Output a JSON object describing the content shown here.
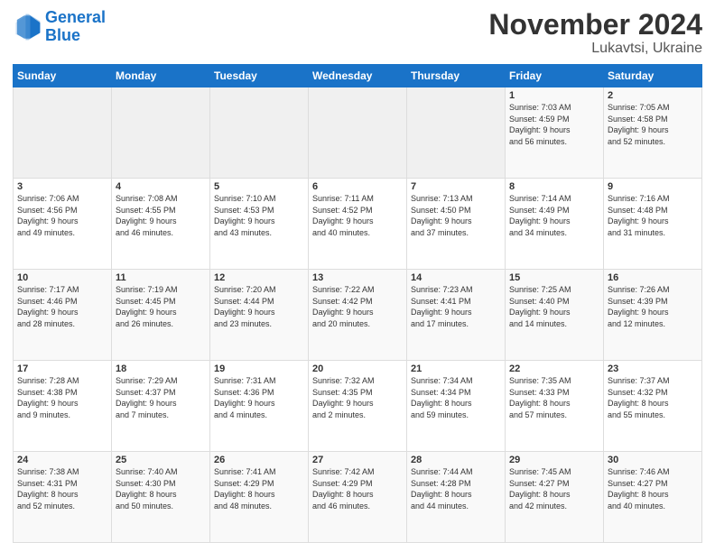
{
  "logo": {
    "line1": "General",
    "line2": "Blue"
  },
  "title": "November 2024",
  "subtitle": "Lukavtsi, Ukraine",
  "days_header": [
    "Sunday",
    "Monday",
    "Tuesday",
    "Wednesday",
    "Thursday",
    "Friday",
    "Saturday"
  ],
  "weeks": [
    [
      {
        "day": "",
        "info": ""
      },
      {
        "day": "",
        "info": ""
      },
      {
        "day": "",
        "info": ""
      },
      {
        "day": "",
        "info": ""
      },
      {
        "day": "",
        "info": ""
      },
      {
        "day": "1",
        "info": "Sunrise: 7:03 AM\nSunset: 4:59 PM\nDaylight: 9 hours\nand 56 minutes."
      },
      {
        "day": "2",
        "info": "Sunrise: 7:05 AM\nSunset: 4:58 PM\nDaylight: 9 hours\nand 52 minutes."
      }
    ],
    [
      {
        "day": "3",
        "info": "Sunrise: 7:06 AM\nSunset: 4:56 PM\nDaylight: 9 hours\nand 49 minutes."
      },
      {
        "day": "4",
        "info": "Sunrise: 7:08 AM\nSunset: 4:55 PM\nDaylight: 9 hours\nand 46 minutes."
      },
      {
        "day": "5",
        "info": "Sunrise: 7:10 AM\nSunset: 4:53 PM\nDaylight: 9 hours\nand 43 minutes."
      },
      {
        "day": "6",
        "info": "Sunrise: 7:11 AM\nSunset: 4:52 PM\nDaylight: 9 hours\nand 40 minutes."
      },
      {
        "day": "7",
        "info": "Sunrise: 7:13 AM\nSunset: 4:50 PM\nDaylight: 9 hours\nand 37 minutes."
      },
      {
        "day": "8",
        "info": "Sunrise: 7:14 AM\nSunset: 4:49 PM\nDaylight: 9 hours\nand 34 minutes."
      },
      {
        "day": "9",
        "info": "Sunrise: 7:16 AM\nSunset: 4:48 PM\nDaylight: 9 hours\nand 31 minutes."
      }
    ],
    [
      {
        "day": "10",
        "info": "Sunrise: 7:17 AM\nSunset: 4:46 PM\nDaylight: 9 hours\nand 28 minutes."
      },
      {
        "day": "11",
        "info": "Sunrise: 7:19 AM\nSunset: 4:45 PM\nDaylight: 9 hours\nand 26 minutes."
      },
      {
        "day": "12",
        "info": "Sunrise: 7:20 AM\nSunset: 4:44 PM\nDaylight: 9 hours\nand 23 minutes."
      },
      {
        "day": "13",
        "info": "Sunrise: 7:22 AM\nSunset: 4:42 PM\nDaylight: 9 hours\nand 20 minutes."
      },
      {
        "day": "14",
        "info": "Sunrise: 7:23 AM\nSunset: 4:41 PM\nDaylight: 9 hours\nand 17 minutes."
      },
      {
        "day": "15",
        "info": "Sunrise: 7:25 AM\nSunset: 4:40 PM\nDaylight: 9 hours\nand 14 minutes."
      },
      {
        "day": "16",
        "info": "Sunrise: 7:26 AM\nSunset: 4:39 PM\nDaylight: 9 hours\nand 12 minutes."
      }
    ],
    [
      {
        "day": "17",
        "info": "Sunrise: 7:28 AM\nSunset: 4:38 PM\nDaylight: 9 hours\nand 9 minutes."
      },
      {
        "day": "18",
        "info": "Sunrise: 7:29 AM\nSunset: 4:37 PM\nDaylight: 9 hours\nand 7 minutes."
      },
      {
        "day": "19",
        "info": "Sunrise: 7:31 AM\nSunset: 4:36 PM\nDaylight: 9 hours\nand 4 minutes."
      },
      {
        "day": "20",
        "info": "Sunrise: 7:32 AM\nSunset: 4:35 PM\nDaylight: 9 hours\nand 2 minutes."
      },
      {
        "day": "21",
        "info": "Sunrise: 7:34 AM\nSunset: 4:34 PM\nDaylight: 8 hours\nand 59 minutes."
      },
      {
        "day": "22",
        "info": "Sunrise: 7:35 AM\nSunset: 4:33 PM\nDaylight: 8 hours\nand 57 minutes."
      },
      {
        "day": "23",
        "info": "Sunrise: 7:37 AM\nSunset: 4:32 PM\nDaylight: 8 hours\nand 55 minutes."
      }
    ],
    [
      {
        "day": "24",
        "info": "Sunrise: 7:38 AM\nSunset: 4:31 PM\nDaylight: 8 hours\nand 52 minutes."
      },
      {
        "day": "25",
        "info": "Sunrise: 7:40 AM\nSunset: 4:30 PM\nDaylight: 8 hours\nand 50 minutes."
      },
      {
        "day": "26",
        "info": "Sunrise: 7:41 AM\nSunset: 4:29 PM\nDaylight: 8 hours\nand 48 minutes."
      },
      {
        "day": "27",
        "info": "Sunrise: 7:42 AM\nSunset: 4:29 PM\nDaylight: 8 hours\nand 46 minutes."
      },
      {
        "day": "28",
        "info": "Sunrise: 7:44 AM\nSunset: 4:28 PM\nDaylight: 8 hours\nand 44 minutes."
      },
      {
        "day": "29",
        "info": "Sunrise: 7:45 AM\nSunset: 4:27 PM\nDaylight: 8 hours\nand 42 minutes."
      },
      {
        "day": "30",
        "info": "Sunrise: 7:46 AM\nSunset: 4:27 PM\nDaylight: 8 hours\nand 40 minutes."
      }
    ]
  ]
}
